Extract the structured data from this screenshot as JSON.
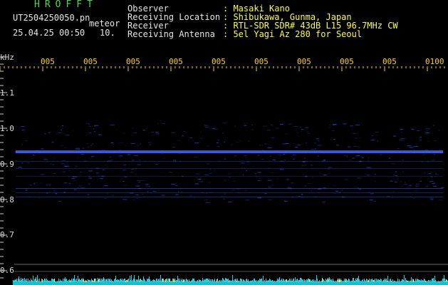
{
  "station": {
    "name": "HROFFT",
    "filename": "UT2504250050.pn",
    "mode_label": "meteor",
    "datetime": "25.04.25 00:50",
    "interval": "10."
  },
  "info": {
    "observer_label": "Observer",
    "observer_value": ": Masaki Kano",
    "location_label": "Receiving Location",
    "location_value": ": Shibukawa, Gunma, Japan",
    "receiver_label": "Receiver",
    "receiver_value": ": RTL-SDR SDR# 43dB L15 96.7MHz CW",
    "antenna_label": "Receiving Antenna",
    "antenna_value": ": 5el Yagi Az 280 for Seoul"
  },
  "axis": {
    "unit": "kHz",
    "y_ticks": [
      "1.1",
      "1.0",
      "0.9",
      "0.8",
      "0.7",
      "0.6"
    ],
    "x_ticks": [
      "005",
      "005",
      "005",
      "005",
      "005",
      "005",
      "005",
      "005",
      "005",
      "0100"
    ]
  },
  "colors": {
    "background": "#000000",
    "title": "#4cd84c",
    "text": "#e6e6e6",
    "info": "#ffff33",
    "ticks": "#ffd21a",
    "signal": "#3a5cff",
    "noise_floor": "#20d0e0",
    "gridline": "#ffffff"
  }
}
